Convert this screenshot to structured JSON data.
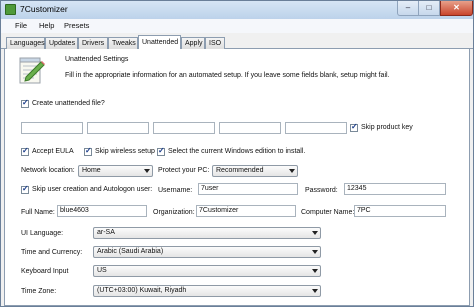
{
  "window": {
    "title": "7Customizer",
    "controls": {
      "minimize": "–",
      "maximize": "□",
      "close": "✕"
    }
  },
  "menu": [
    "File",
    "Help",
    "Presets"
  ],
  "tabs": [
    "Languages",
    "Updates",
    "Drivers",
    "Tweaks",
    "Unattended",
    "Apply",
    "ISO"
  ],
  "active_tab": "Unattended",
  "header": {
    "title": "Unattended Settings",
    "description": "Fill in the appropriate information for an automated setup. If you leave some fields blank, setup might fail."
  },
  "create_file": {
    "label": "Create unattended file?",
    "checked": true
  },
  "product_key": {
    "fields": [
      "",
      "",
      "",
      "",
      ""
    ],
    "skip_label": "Skip product key",
    "skip_checked": true
  },
  "options": [
    {
      "label": "Accept EULA",
      "checked": true
    },
    {
      "label": "Skip wireless setup",
      "checked": true
    },
    {
      "label": "Select the current Windows edition to install.",
      "checked": true
    }
  ],
  "network": {
    "label": "Network location:",
    "value": "Home"
  },
  "protect": {
    "label": "Protect your PC:",
    "value": "Recommended"
  },
  "skip_user": {
    "label": "Skip user creation and Autologon user:",
    "checked": true
  },
  "username": {
    "label": "Username:",
    "value": "7user"
  },
  "password": {
    "label": "Password:",
    "value": "12345"
  },
  "full_name": {
    "label": "Full Name:",
    "value": "blue4603"
  },
  "organization": {
    "label": "Organization:",
    "value": "7Customizer"
  },
  "computer_name": {
    "label": "Computer Name:",
    "value": "7PC"
  },
  "ui_language": {
    "label": "UI Language:",
    "value": "ar-SA"
  },
  "time_currency": {
    "label": "Time and Currency:",
    "value": "Arabic (Saudi Arabia)"
  },
  "keyboard": {
    "label": "Keyboard Input",
    "value": "US"
  },
  "time_zone": {
    "label": "Time Zone:",
    "value": "(UTC+03:00) Kuwait, Riyadh"
  }
}
